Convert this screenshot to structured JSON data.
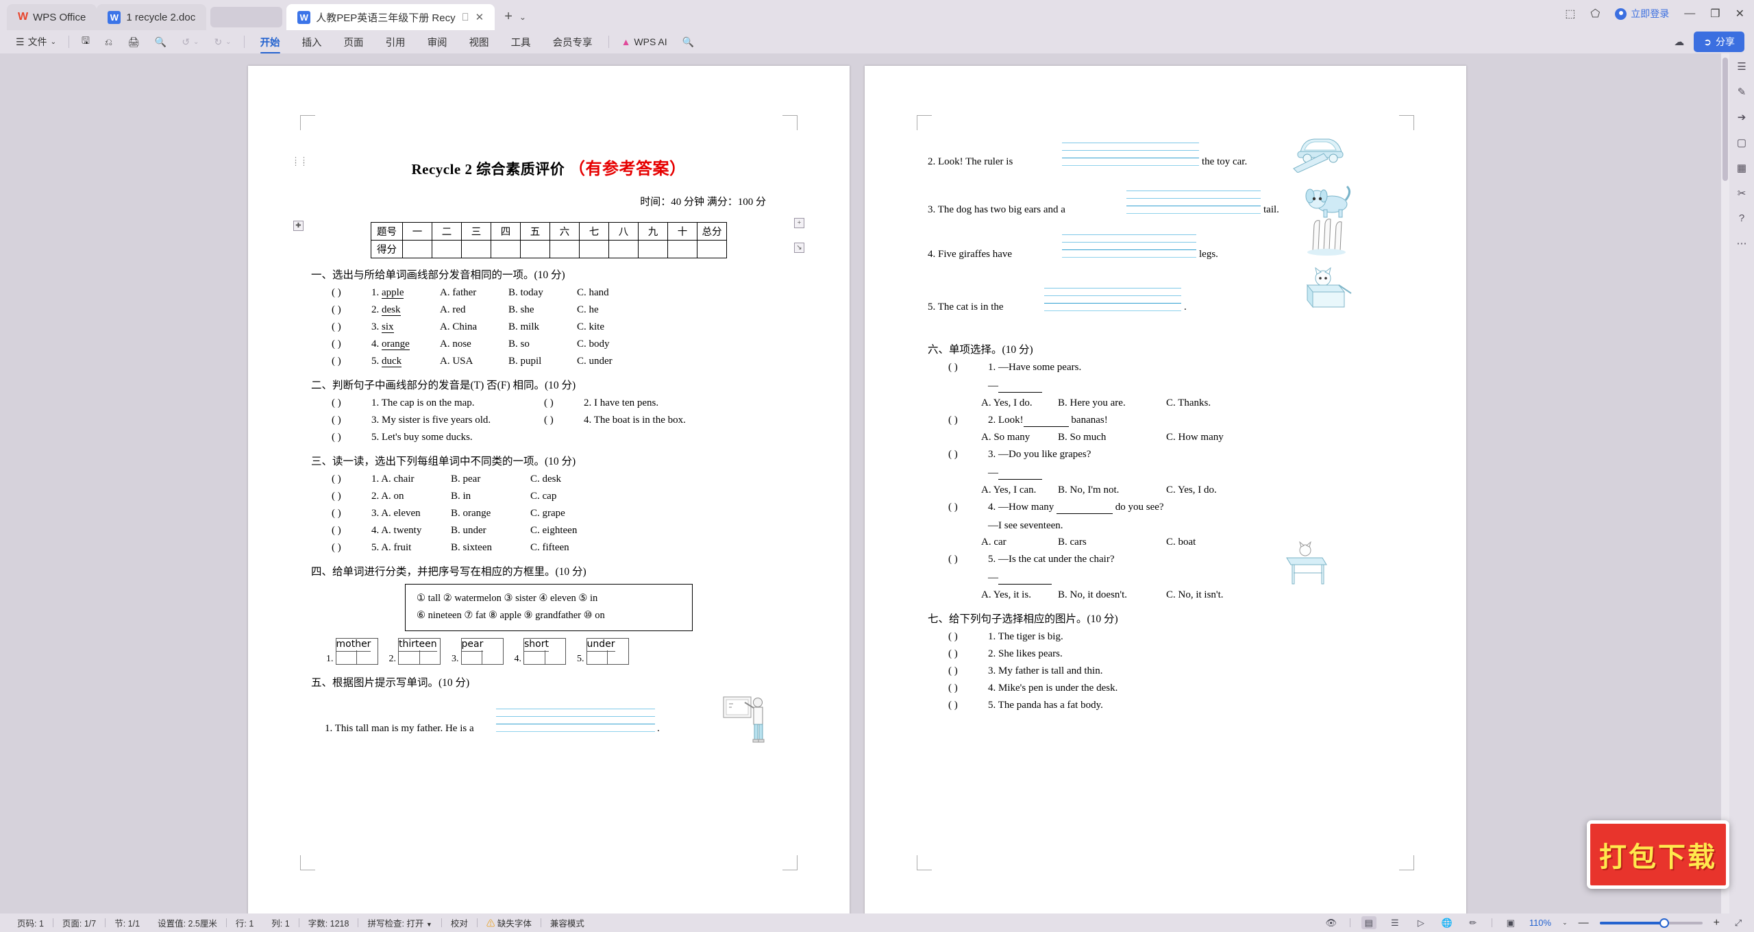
{
  "titlebar": {
    "app_name": "WPS Office",
    "tabs": [
      {
        "label": "1 recycle 2.doc",
        "icon": "word-doc-icon",
        "active": false
      },
      {
        "label": "人教PEP英语三年级下册 Recy",
        "icon": "word-doc-icon",
        "active": true
      }
    ],
    "new_tab": "+",
    "new_tab_caret": "⌄",
    "login_label": "立即登录",
    "minimize": "—",
    "maximize": "❐",
    "close": "✕"
  },
  "ribbon": {
    "file_menu": "文件",
    "file_caret": "⌄",
    "quick_icons": [
      "save-icon",
      "cloud-save-icon",
      "print-icon",
      "print-preview-icon"
    ],
    "undo": "↺",
    "undo_caret": "⌄",
    "redo": "↻",
    "more_caret": "⌄",
    "tabs": [
      {
        "label": "开始",
        "selected": true
      },
      {
        "label": "插入",
        "selected": false
      },
      {
        "label": "页面",
        "selected": false
      },
      {
        "label": "引用",
        "selected": false
      },
      {
        "label": "审阅",
        "selected": false
      },
      {
        "label": "视图",
        "selected": false
      },
      {
        "label": "工具",
        "selected": false
      },
      {
        "label": "会员专享",
        "selected": false
      }
    ],
    "ai_label": "WPS AI",
    "search_icon": "search-icon",
    "share_label": "分享",
    "cloud_icon": "cloud-icon",
    "help_icon": "help-icon"
  },
  "document": {
    "title_main": "Recycle 2  综合素质评价",
    "title_answer": "（有参考答案）",
    "meta": "时间：40 分钟   满分：100 分",
    "score_table": {
      "row1": [
        "题号",
        "一",
        "二",
        "三",
        "四",
        "五",
        "六",
        "七",
        "八",
        "九",
        "十",
        "总分"
      ],
      "row2": [
        "得分",
        "",
        "",
        "",
        "",
        "",
        "",
        "",
        "",
        "",
        "",
        ""
      ]
    },
    "sections": [
      {
        "heading": "一、选出与所给单词画线部分发音相同的一项。(10 分)",
        "type": "choice4",
        "items": [
          {
            "paren": "(         )",
            "num": "1.",
            "stem": "apple",
            "a": "A. father",
            "b": "B. today",
            "c": "C. hand"
          },
          {
            "paren": "(         )",
            "num": "2.",
            "stem": "desk",
            "a": "A. red",
            "b": "B. she",
            "c": "C. he"
          },
          {
            "paren": "(         )",
            "num": "3.",
            "stem": "six",
            "a": "A. China",
            "b": "B. milk",
            "c": "C. kite"
          },
          {
            "paren": "(         )",
            "num": "4.",
            "stem": "orange",
            "a": "A. nose",
            "b": "B. so",
            "c": "C. body"
          },
          {
            "paren": "(         )",
            "num": "5.",
            "stem": "duck",
            "a": "A. USA",
            "b": "B. pupil",
            "c": "C. under"
          }
        ]
      },
      {
        "heading": "二、判断句子中画线部分的发音是(T) 否(F) 相同。(10 分)",
        "type": "two-col",
        "items": [
          {
            "paren": "(         )",
            "text": "1. The cap is on the map."
          },
          {
            "paren": "(         )",
            "text": "2. I have ten pens."
          },
          {
            "paren": "(         )",
            "text": "3. My sister is five years old."
          },
          {
            "paren": "(         )",
            "text": "4. The boat is in the box."
          },
          {
            "paren": "(         )",
            "text": "5. Let's buy some ducks."
          }
        ]
      },
      {
        "heading": "三、读一读，选出下列每组单词中不同类的一项。(10 分)",
        "type": "choice3",
        "items": [
          {
            "paren": "(         )",
            "num": "1.",
            "a": "A. chair",
            "b": "B. pear",
            "c": "C. desk"
          },
          {
            "paren": "(         )",
            "num": "2.",
            "a": "A. on",
            "b": "B. in",
            "c": "C. cap"
          },
          {
            "paren": "(         )",
            "num": "3.",
            "a": "A. eleven",
            "b": "B. orange",
            "c": "C. grape"
          },
          {
            "paren": "(         )",
            "num": "4.",
            "a": "A. twenty",
            "b": "B. under",
            "c": "C. eighteen"
          },
          {
            "paren": "(         )",
            "num": "5.",
            "a": "A. fruit",
            "b": "B. sixteen",
            "c": "C. fifteen"
          }
        ]
      },
      {
        "heading": "四、给单词进行分类，并把序号写在相应的方框里。(10 分)",
        "type": "wordbank",
        "bank_line1": "① tall ② watermelon ③ sister ④ eleven ⑤ in",
        "bank_line2": "⑥ nineteen ⑦ fat ⑧ apple ⑨ grandfather ⑩ on",
        "boxes": [
          {
            "index": "1.",
            "word": "mother"
          },
          {
            "index": "2.",
            "word": "thirteen"
          },
          {
            "index": "3.",
            "word": "pear"
          },
          {
            "index": "4.",
            "word": "short"
          },
          {
            "index": "5.",
            "word": "under"
          }
        ]
      },
      {
        "heading": "五、根据图片提示写单词。(10 分)",
        "type": "picture-words",
        "items": [
          {
            "text_before": "1. This tall man is my father. He is a",
            "text_after": ".",
            "clipart": "teacher-at-whiteboard-icon"
          }
        ]
      }
    ],
    "page2": {
      "picture_words_cont": [
        {
          "text_before": "2. Look! The ruler is",
          "text_after": "the toy car.",
          "clipart": "toy-car-on-ruler-icon"
        },
        {
          "text_before": "3. The dog has two big ears and a",
          "text_after": "tail.",
          "clipart": "dog-icon"
        },
        {
          "text_before": "4. Five giraffes have",
          "text_after": "legs.",
          "clipart": "giraffes-icon"
        },
        {
          "text_before": "5. The cat is in the",
          "text_after": ".",
          "clipart": "cat-in-box-icon"
        }
      ],
      "section6": {
        "heading": "六、单项选择。(10 分)",
        "items": [
          {
            "paren": "(         )",
            "num": "1.",
            "q": "—Have some pears.",
            "answer_dash": "—",
            "a": "A. Yes, I do.",
            "b": "B. Here you are.",
            "c": "C. Thanks."
          },
          {
            "paren": "(         )",
            "num": "2.",
            "q_before": "Look!",
            "q_after": "bananas!",
            "a": "A. So many",
            "b": "B. So much",
            "c": "C. How many"
          },
          {
            "paren": "(         )",
            "num": "3.",
            "q": "—Do you like grapes?",
            "answer_dash": "—",
            "a": "A. Yes, I can.",
            "b": "B. No, I'm not.",
            "c": "C. Yes, I do."
          },
          {
            "paren": "(         )",
            "num": "4.",
            "q_before": "—How many",
            "q_after": "do you see?",
            "q2": "—I see seventeen.",
            "a": "A. car",
            "b": "B. cars",
            "c": "C. boat"
          },
          {
            "paren": "(         )",
            "num": "5.",
            "q": "—Is the cat under the chair?",
            "answer_dash": "—",
            "a": "A. Yes, it is.",
            "b": "B. No, it doesn't.",
            "c": "C. No, it isn't.",
            "clipart": "cat-on-desk-icon"
          }
        ]
      },
      "section7": {
        "heading": "七、给下列句子选择相应的图片。(10 分)",
        "items": [
          {
            "paren": "(         )",
            "text": "1. The tiger is big."
          },
          {
            "paren": "(         )",
            "text": "2. She likes pears."
          },
          {
            "paren": "(         )",
            "text": "3. My father is tall and thin."
          },
          {
            "paren": "(         )",
            "text": "4. Mike's pen is under the desk."
          },
          {
            "paren": "(         )",
            "text": "5. The panda has a fat body."
          }
        ]
      }
    }
  },
  "statusbar": {
    "left": [
      "页码: 1",
      "页面: 1/7",
      "节: 1/1",
      "设置值: 2.5厘米",
      "行: 1",
      "列: 1",
      "字数: 1218",
      "拼写检查: 打开",
      "校对",
      "缺失字体",
      "兼容模式"
    ],
    "zoom": "110%",
    "zoom_caret": "⌄",
    "minus": "—",
    "plus": "+",
    "view_icons": [
      "eye-icon",
      "page-layout-icon",
      "outline-icon",
      "presentation-icon",
      "web-layout-icon",
      "brush-icon",
      "fullscreen-icon",
      "expand-icon"
    ]
  },
  "overlay": {
    "download_badge": "打包下载",
    "badge_bg": "#e8342c",
    "badge_text_color": "#ffe94d"
  },
  "rail_icons": [
    "pin-icon",
    "pen-icon",
    "cursor-icon",
    "shapes-icon",
    "table-icon",
    "scissors-icon",
    "help-icon",
    "more-icon"
  ]
}
